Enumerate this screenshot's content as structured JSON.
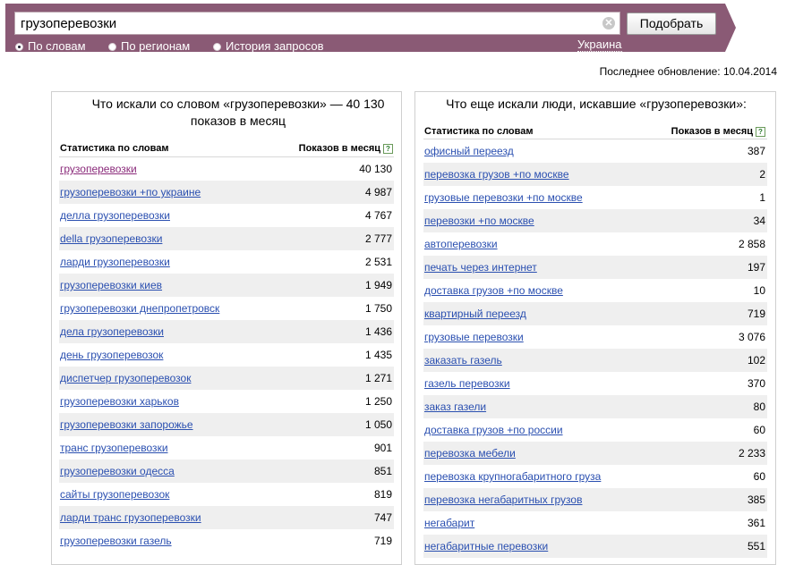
{
  "search": {
    "query": "грузоперевозки",
    "submit_label": "Подобрать",
    "clear_glyph": "✕",
    "modes": [
      {
        "label": "По словам",
        "selected": true
      },
      {
        "label": "По регионам",
        "selected": false
      },
      {
        "label": "История запросов",
        "selected": false
      }
    ],
    "region": "Украина"
  },
  "last_update": "Последнее обновление: 10.04.2014",
  "left_panel": {
    "title": "Что искали со словом «грузоперевозки» — 40 130 показов в месяц",
    "col_keyword": "Статистика по словам",
    "col_count": "Показов в месяц",
    "help_glyph": "?",
    "rows": [
      {
        "keyword": "грузоперевозки",
        "count": "40 130"
      },
      {
        "keyword": "грузоперевозки +по украине",
        "count": "4 987"
      },
      {
        "keyword": "делла грузоперевозки",
        "count": "4 767"
      },
      {
        "keyword": "della грузоперевозки",
        "count": "2 777"
      },
      {
        "keyword": "ларди грузоперевозки",
        "count": "2 531"
      },
      {
        "keyword": "грузоперевозки киев",
        "count": "1 949"
      },
      {
        "keyword": "грузоперевозки днепропетровск",
        "count": "1 750"
      },
      {
        "keyword": "дела грузоперевозки",
        "count": "1 436"
      },
      {
        "keyword": "день грузоперевозок",
        "count": "1 435"
      },
      {
        "keyword": "диспетчер грузоперевозок",
        "count": "1 271"
      },
      {
        "keyword": "грузоперевозки харьков",
        "count": "1 250"
      },
      {
        "keyword": "грузоперевозки запорожье",
        "count": "1 050"
      },
      {
        "keyword": "транс грузоперевозки",
        "count": "901"
      },
      {
        "keyword": "грузоперевозки одесса",
        "count": "851"
      },
      {
        "keyword": "сайты грузоперевозок",
        "count": "819"
      },
      {
        "keyword": "ларди транс грузоперевозки",
        "count": "747"
      },
      {
        "keyword": "грузоперевозки газель",
        "count": "719"
      }
    ]
  },
  "right_panel": {
    "title": "Что еще искали люди, искавшие «грузоперевозки»:",
    "col_keyword": "Статистика по словам",
    "col_count": "Показов в месяц",
    "help_glyph": "?",
    "rows": [
      {
        "keyword": "офисный переезд",
        "count": "387"
      },
      {
        "keyword": "перевозка грузов +по москве",
        "count": "2"
      },
      {
        "keyword": "грузовые перевозки +по москве",
        "count": "1"
      },
      {
        "keyword": "перевозки +по москве",
        "count": "34"
      },
      {
        "keyword": "автоперевозки",
        "count": "2 858"
      },
      {
        "keyword": "печать через интернет",
        "count": "197"
      },
      {
        "keyword": "доставка грузов +по москве",
        "count": "10"
      },
      {
        "keyword": "квартирный переезд",
        "count": "719"
      },
      {
        "keyword": "грузовые перевозки",
        "count": "3 076"
      },
      {
        "keyword": "заказать газель",
        "count": "102"
      },
      {
        "keyword": "газель перевозки",
        "count": "370"
      },
      {
        "keyword": "заказ газели",
        "count": "80"
      },
      {
        "keyword": "доставка грузов +по россии",
        "count": "60"
      },
      {
        "keyword": "перевозка мебели",
        "count": "2 233"
      },
      {
        "keyword": "перевозка крупногабаритного груза",
        "count": "60"
      },
      {
        "keyword": "перевозка негабаритных грузов",
        "count": "385"
      },
      {
        "keyword": "негабарит",
        "count": "361"
      },
      {
        "keyword": "негабаритные перевозки",
        "count": "551"
      }
    ]
  }
}
